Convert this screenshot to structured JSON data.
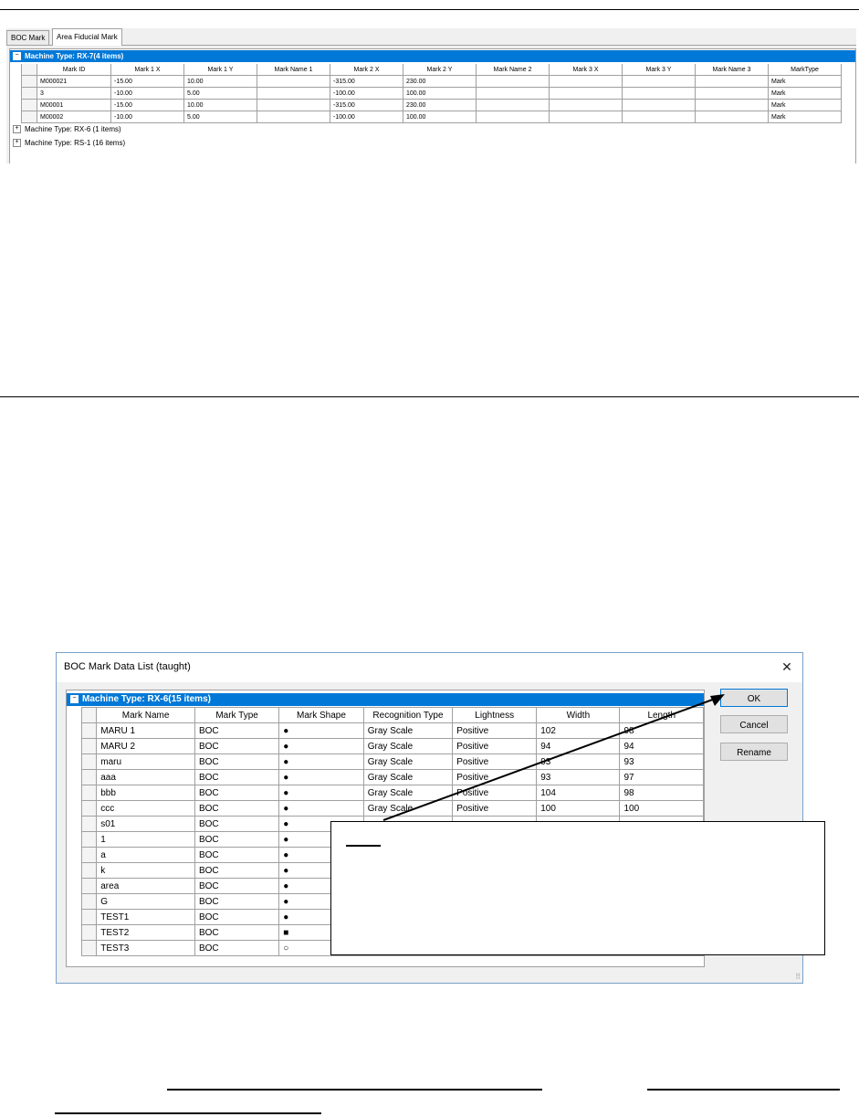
{
  "upper": {
    "tabs": [
      "BOC Mark",
      "Area Fiducial Mark"
    ],
    "groups": [
      "Machine Type: RX-7(4 items)",
      "Machine Type: RX-6 (1 items)",
      "Machine Type: RS-1 (16 items)"
    ],
    "columns": [
      "Mark ID",
      "Mark 1 X",
      "Mark 1 Y",
      "Mark Name 1",
      "Mark 2 X",
      "Mark 2 Y",
      "Mark Name 2",
      "Mark 3 X",
      "Mark 3 Y",
      "Mark Name 3",
      "MarkType"
    ],
    "rows": [
      [
        "M000021",
        "-15.00",
        "10.00",
        "",
        "-315.00",
        "230.00",
        "",
        "",
        "",
        "",
        "Mark"
      ],
      [
        "3",
        "-10.00",
        "5.00",
        "",
        "-100.00",
        "100.00",
        "",
        "",
        "",
        "",
        "Mark"
      ],
      [
        "M00001",
        "-15.00",
        "10.00",
        "",
        "-315.00",
        "230.00",
        "",
        "",
        "",
        "",
        "Mark"
      ],
      [
        "M00002",
        "-10.00",
        "5.00",
        "",
        "-100.00",
        "100.00",
        "",
        "",
        "",
        "",
        "Mark"
      ]
    ]
  },
  "dialog": {
    "title": "BOC Mark Data List (taught)",
    "close_glyph": "✕",
    "group": "Machine Type: RX-6(15 items)",
    "columns": [
      "Mark Name",
      "Mark Type",
      "Mark Shape",
      "Recognition Type",
      "Lightness",
      "Width",
      "Length"
    ],
    "rows": [
      [
        "MARU 1",
        "BOC",
        "●",
        "Gray Scale",
        "Positive",
        "102",
        "98"
      ],
      [
        "MARU 2",
        "BOC",
        "●",
        "Gray Scale",
        "Positive",
        "94",
        "94"
      ],
      [
        "maru",
        "BOC",
        "●",
        "Gray Scale",
        "Positive",
        "93",
        "93"
      ],
      [
        "aaa",
        "BOC",
        "●",
        "Gray Scale",
        "Positive",
        "93",
        "97"
      ],
      [
        "bbb",
        "BOC",
        "●",
        "Gray Scale",
        "Positive",
        "104",
        "98"
      ],
      [
        "ccc",
        "BOC",
        "●",
        "Gray Scale",
        "Positive",
        "100",
        "100"
      ],
      [
        "s01",
        "BOC",
        "●",
        "",
        "",
        "",
        ""
      ],
      [
        "1",
        "BOC",
        "●",
        "",
        "",
        "",
        ""
      ],
      [
        "a",
        "BOC",
        "●",
        "",
        "",
        "",
        ""
      ],
      [
        "k",
        "BOC",
        "●",
        "",
        "",
        "",
        ""
      ],
      [
        "area",
        "BOC",
        "●",
        "",
        "",
        "",
        ""
      ],
      [
        "G",
        "BOC",
        "●",
        "",
        "",
        "",
        ""
      ],
      [
        "TEST1",
        "BOC",
        "●",
        "",
        "",
        "",
        ""
      ],
      [
        "TEST2",
        "BOC",
        "■",
        "",
        "",
        "",
        ""
      ],
      [
        "TEST3",
        "BOC",
        "○",
        "",
        "",
        "",
        ""
      ]
    ],
    "buttons": {
      "ok": "OK",
      "cancel": "Cancel",
      "rename": "Rename"
    }
  },
  "colors": {
    "selection": "#0078d7",
    "dialog_bg": "#f0f0f0"
  }
}
